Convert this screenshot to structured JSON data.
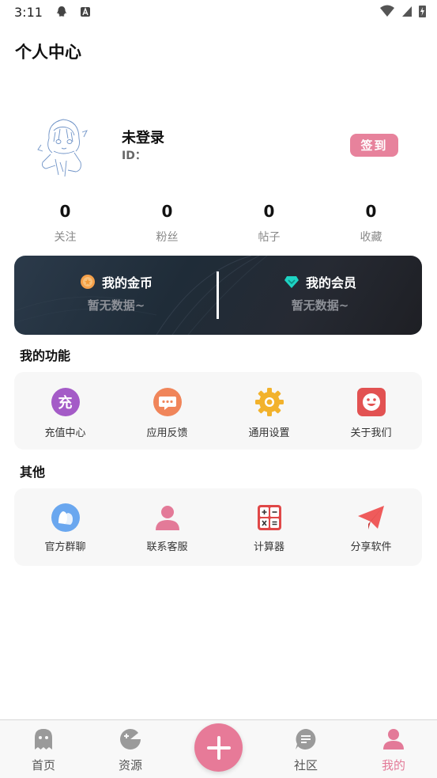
{
  "status_bar": {
    "time": "3:11"
  },
  "header": {
    "title": "个人中心"
  },
  "profile": {
    "name": "未登录",
    "id_label": "ID：",
    "signin_label": "签到"
  },
  "stats": [
    {
      "value": "0",
      "label": "关注"
    },
    {
      "value": "0",
      "label": "粉丝"
    },
    {
      "value": "0",
      "label": "帖子"
    },
    {
      "value": "0",
      "label": "收藏"
    }
  ],
  "wallet": {
    "coins": {
      "title": "我的金币",
      "sub": "暂无数据~",
      "icon": "coin-icon"
    },
    "vip": {
      "title": "我的会员",
      "sub": "暂无数据~",
      "icon": "diamond-icon"
    }
  },
  "functions": {
    "title": "我的功能",
    "items": [
      {
        "label": "充值中心",
        "icon": "recharge-icon",
        "glyph": "充",
        "color": "#a45bc7"
      },
      {
        "label": "应用反馈",
        "icon": "feedback-icon",
        "color": "#f0855a"
      },
      {
        "label": "通用设置",
        "icon": "settings-gear-icon",
        "color": "#f2b22c"
      },
      {
        "label": "关于我们",
        "icon": "about-smile-icon",
        "color": "#e25252"
      }
    ]
  },
  "others": {
    "title": "其他",
    "items": [
      {
        "label": "官方群聊",
        "icon": "group-chat-icon",
        "color": "#6aa7ef"
      },
      {
        "label": "联系客服",
        "icon": "customer-service-icon",
        "color": "#e37a98"
      },
      {
        "label": "计算器",
        "icon": "calculator-icon",
        "color": "#e04848"
      },
      {
        "label": "分享软件",
        "icon": "share-plane-icon",
        "color": "#ef5b5b"
      }
    ]
  },
  "bottom_nav": {
    "items": [
      {
        "label": "首页",
        "icon": "ghost-icon"
      },
      {
        "label": "资源",
        "icon": "gamepad-icon"
      },
      {
        "label": "社区",
        "icon": "chat-bubble-icon"
      },
      {
        "label": "我的",
        "icon": "person-icon",
        "active": true
      }
    ],
    "add_icon": "plus-icon",
    "active_color": "#e37a98"
  }
}
